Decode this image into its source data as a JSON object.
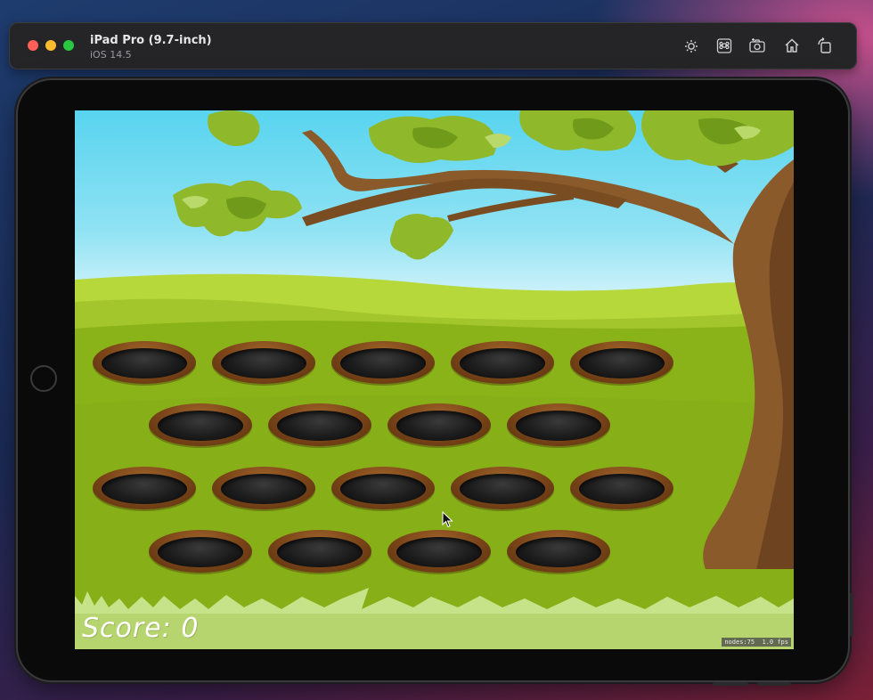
{
  "titlebar": {
    "device_name": "iPad Pro (9.7-inch)",
    "os_version": "iOS 14.5",
    "icons": [
      "brightness-icon",
      "command-icon",
      "screenshot-icon",
      "home-icon",
      "rotate-icon"
    ]
  },
  "game": {
    "score_label": "Score:",
    "score_value": "0",
    "stats": "nodes:75  1.0 fps",
    "hole_rows": [
      5,
      4,
      5,
      4
    ]
  },
  "colors": {
    "grass": "#8ab219",
    "sky": "#58d4ef",
    "trunk": "#8a5a2b"
  }
}
